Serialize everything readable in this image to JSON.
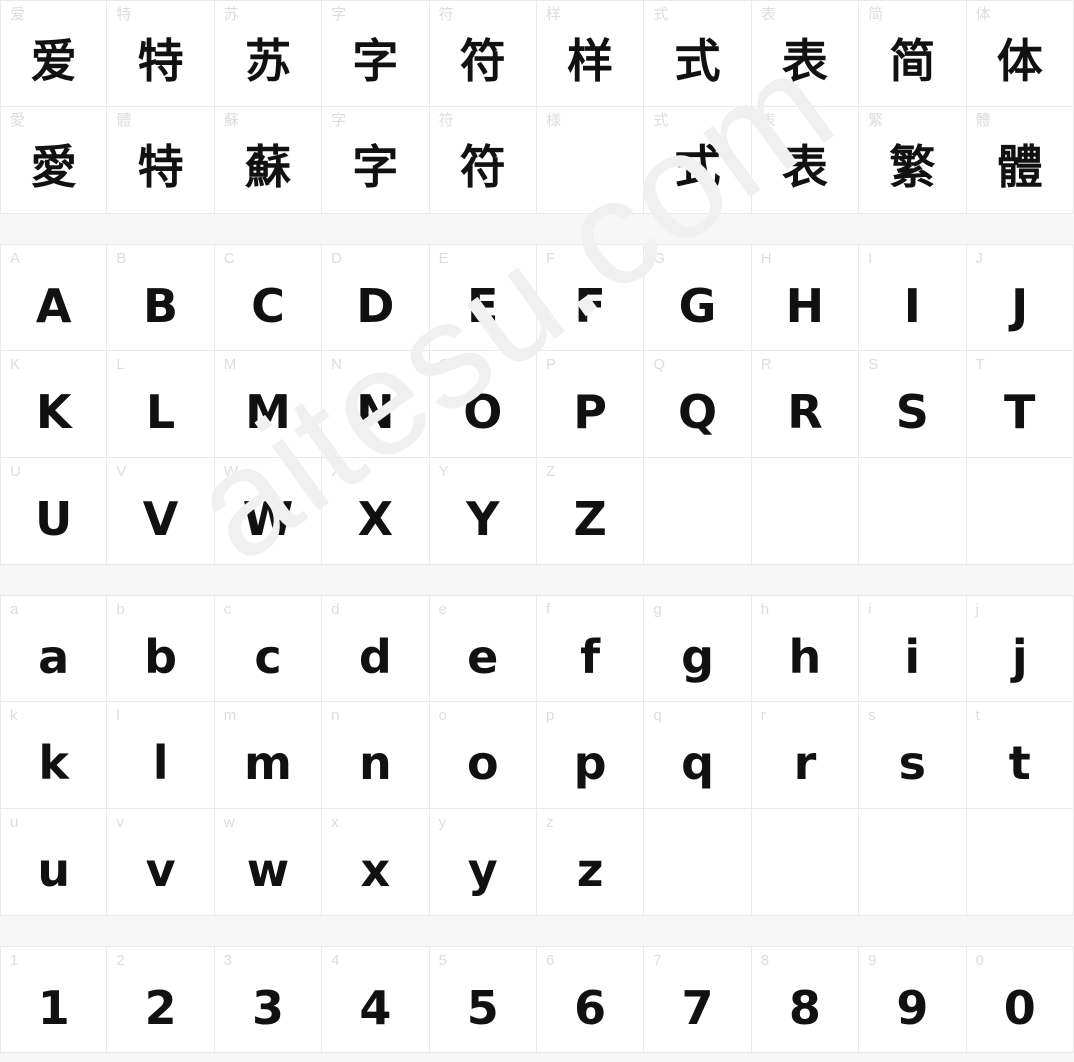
{
  "page": {
    "background_color": "#f7f7f7",
    "cell_background_color": "#ffffff",
    "grid_line_color": "#eaeaea",
    "label_color": "#dddddd",
    "glyph_color": "#111111",
    "columns": 10
  },
  "watermark": {
    "text": "aitesu.com",
    "color": "#f0f0f0",
    "rotation_deg": -36
  },
  "sections": [
    {
      "name": "cjk-sample",
      "rows": [
        [
          {
            "label": "爱",
            "glyph": "爱",
            "kind": "cjk"
          },
          {
            "label": "特",
            "glyph": "特",
            "kind": "cjk"
          },
          {
            "label": "苏",
            "glyph": "苏",
            "kind": "cjk"
          },
          {
            "label": "字",
            "glyph": "字",
            "kind": "cjk"
          },
          {
            "label": "符",
            "glyph": "符",
            "kind": "cjk"
          },
          {
            "label": "样",
            "glyph": "样",
            "kind": "cjk"
          },
          {
            "label": "式",
            "glyph": "式",
            "kind": "cjk"
          },
          {
            "label": "表",
            "glyph": "表",
            "kind": "cjk"
          },
          {
            "label": "简",
            "glyph": "简",
            "kind": "cjk"
          },
          {
            "label": "体",
            "glyph": "体",
            "kind": "cjk"
          }
        ],
        [
          {
            "label": "愛",
            "glyph": "愛",
            "kind": "cjk"
          },
          {
            "label": "體",
            "glyph": "特",
            "kind": "cjk"
          },
          {
            "label": "蘇",
            "glyph": "蘇",
            "kind": "cjk"
          },
          {
            "label": "字",
            "glyph": "字",
            "kind": "cjk"
          },
          {
            "label": "符",
            "glyph": "符",
            "kind": "cjk"
          },
          {
            "label": "様",
            "glyph": "",
            "kind": "cjk"
          },
          {
            "label": "式",
            "glyph": "式",
            "kind": "cjk"
          },
          {
            "label": "表",
            "glyph": "表",
            "kind": "cjk"
          },
          {
            "label": "繁",
            "glyph": "繁",
            "kind": "cjk"
          },
          {
            "label": "體",
            "glyph": "體",
            "kind": "cjk"
          }
        ]
      ]
    },
    {
      "name": "uppercase-latin",
      "rows": [
        [
          {
            "label": "A",
            "glyph": "A",
            "kind": "latin"
          },
          {
            "label": "B",
            "glyph": "B",
            "kind": "latin"
          },
          {
            "label": "C",
            "glyph": "C",
            "kind": "latin"
          },
          {
            "label": "D",
            "glyph": "D",
            "kind": "latin"
          },
          {
            "label": "E",
            "glyph": "E",
            "kind": "latin"
          },
          {
            "label": "F",
            "glyph": "F",
            "kind": "latin"
          },
          {
            "label": "G",
            "glyph": "G",
            "kind": "latin"
          },
          {
            "label": "H",
            "glyph": "H",
            "kind": "latin"
          },
          {
            "label": "I",
            "glyph": "I",
            "kind": "latin"
          },
          {
            "label": "J",
            "glyph": "J",
            "kind": "latin"
          }
        ],
        [
          {
            "label": "K",
            "glyph": "K",
            "kind": "latin"
          },
          {
            "label": "L",
            "glyph": "L",
            "kind": "latin"
          },
          {
            "label": "M",
            "glyph": "M",
            "kind": "latin"
          },
          {
            "label": "N",
            "glyph": "N",
            "kind": "latin"
          },
          {
            "label": "O",
            "glyph": "O",
            "kind": "latin"
          },
          {
            "label": "P",
            "glyph": "P",
            "kind": "latin"
          },
          {
            "label": "Q",
            "glyph": "Q",
            "kind": "latin"
          },
          {
            "label": "R",
            "glyph": "R",
            "kind": "latin"
          },
          {
            "label": "S",
            "glyph": "S",
            "kind": "latin"
          },
          {
            "label": "T",
            "glyph": "T",
            "kind": "latin"
          }
        ],
        [
          {
            "label": "U",
            "glyph": "U",
            "kind": "latin"
          },
          {
            "label": "V",
            "glyph": "V",
            "kind": "latin"
          },
          {
            "label": "W",
            "glyph": "W",
            "kind": "latin"
          },
          {
            "label": "X",
            "glyph": "X",
            "kind": "latin"
          },
          {
            "label": "Y",
            "glyph": "Y",
            "kind": "latin"
          },
          {
            "label": "Z",
            "glyph": "Z",
            "kind": "latin"
          },
          {
            "label": "",
            "glyph": "",
            "kind": "latin"
          },
          {
            "label": "",
            "glyph": "",
            "kind": "latin"
          },
          {
            "label": "",
            "glyph": "",
            "kind": "latin"
          },
          {
            "label": "",
            "glyph": "",
            "kind": "latin"
          }
        ]
      ]
    },
    {
      "name": "lowercase-latin",
      "rows": [
        [
          {
            "label": "a",
            "glyph": "a",
            "kind": "latin"
          },
          {
            "label": "b",
            "glyph": "b",
            "kind": "latin"
          },
          {
            "label": "c",
            "glyph": "c",
            "kind": "latin"
          },
          {
            "label": "d",
            "glyph": "d",
            "kind": "latin"
          },
          {
            "label": "e",
            "glyph": "e",
            "kind": "latin"
          },
          {
            "label": "f",
            "glyph": "f",
            "kind": "latin"
          },
          {
            "label": "g",
            "glyph": "g",
            "kind": "latin"
          },
          {
            "label": "h",
            "glyph": "h",
            "kind": "latin"
          },
          {
            "label": "i",
            "glyph": "i",
            "kind": "latin"
          },
          {
            "label": "j",
            "glyph": "j",
            "kind": "latin"
          }
        ],
        [
          {
            "label": "k",
            "glyph": "k",
            "kind": "latin"
          },
          {
            "label": "l",
            "glyph": "l",
            "kind": "latin"
          },
          {
            "label": "m",
            "glyph": "m",
            "kind": "latin"
          },
          {
            "label": "n",
            "glyph": "n",
            "kind": "latin"
          },
          {
            "label": "o",
            "glyph": "o",
            "kind": "latin"
          },
          {
            "label": "p",
            "glyph": "p",
            "kind": "latin"
          },
          {
            "label": "q",
            "glyph": "q",
            "kind": "latin"
          },
          {
            "label": "r",
            "glyph": "r",
            "kind": "latin"
          },
          {
            "label": "s",
            "glyph": "s",
            "kind": "latin"
          },
          {
            "label": "t",
            "glyph": "t",
            "kind": "latin"
          }
        ],
        [
          {
            "label": "u",
            "glyph": "u",
            "kind": "latin"
          },
          {
            "label": "v",
            "glyph": "v",
            "kind": "latin"
          },
          {
            "label": "w",
            "glyph": "w",
            "kind": "latin"
          },
          {
            "label": "x",
            "glyph": "x",
            "kind": "latin"
          },
          {
            "label": "y",
            "glyph": "y",
            "kind": "latin"
          },
          {
            "label": "z",
            "glyph": "z",
            "kind": "latin"
          },
          {
            "label": "",
            "glyph": "",
            "kind": "latin"
          },
          {
            "label": "",
            "glyph": "",
            "kind": "latin"
          },
          {
            "label": "",
            "glyph": "",
            "kind": "latin"
          },
          {
            "label": "",
            "glyph": "",
            "kind": "latin"
          }
        ]
      ]
    },
    {
      "name": "digits",
      "rows": [
        [
          {
            "label": "1",
            "glyph": "1",
            "kind": "digit"
          },
          {
            "label": "2",
            "glyph": "2",
            "kind": "digit"
          },
          {
            "label": "3",
            "glyph": "3",
            "kind": "digit"
          },
          {
            "label": "4",
            "glyph": "4",
            "kind": "digit"
          },
          {
            "label": "5",
            "glyph": "5",
            "kind": "digit"
          },
          {
            "label": "6",
            "glyph": "6",
            "kind": "digit"
          },
          {
            "label": "7",
            "glyph": "7",
            "kind": "digit"
          },
          {
            "label": "8",
            "glyph": "8",
            "kind": "digit"
          },
          {
            "label": "9",
            "glyph": "9",
            "kind": "digit"
          },
          {
            "label": "0",
            "glyph": "0",
            "kind": "digit"
          }
        ]
      ]
    }
  ]
}
